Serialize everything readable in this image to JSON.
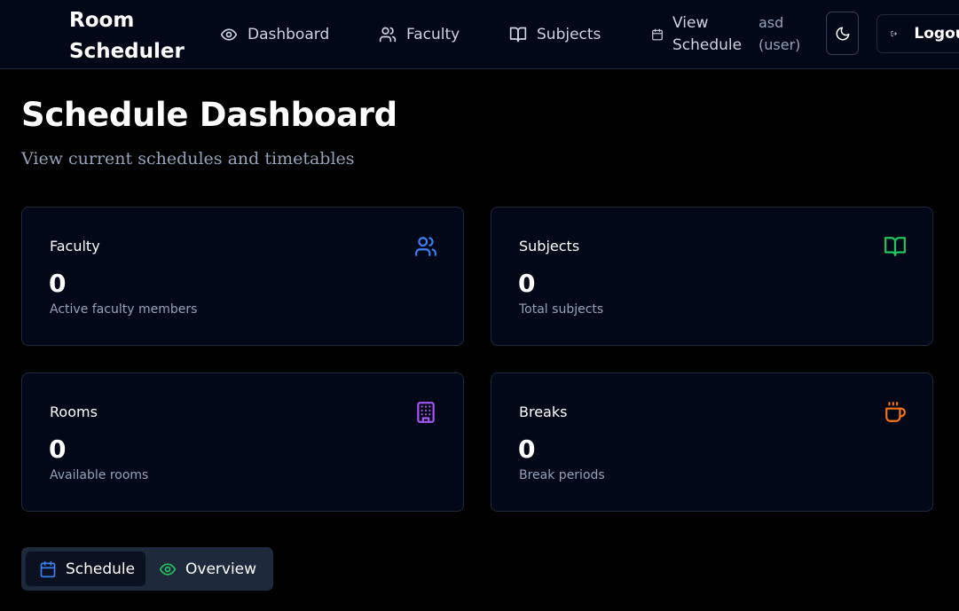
{
  "app": {
    "title_line1": "Room",
    "title_line2": "Scheduler"
  },
  "nav": {
    "dashboard": "Dashboard",
    "faculty": "Faculty",
    "subjects": "Subjects",
    "view_schedule_line1": "View",
    "view_schedule_line2": "Schedule",
    "user_line1": "asd",
    "user_line2": "(user)",
    "logout": "Logout"
  },
  "header": {
    "title": "Schedule Dashboard",
    "subtitle": "View current schedules and timetables"
  },
  "cards": {
    "faculty": {
      "title": "Faculty",
      "value": "0",
      "desc": "Active faculty members",
      "icon": "users-icon",
      "color": "#3b82f6"
    },
    "subjects": {
      "title": "Subjects",
      "value": "0",
      "desc": "Total subjects",
      "icon": "book-open-icon",
      "color": "#22c55e"
    },
    "rooms": {
      "title": "Rooms",
      "value": "0",
      "desc": "Available rooms",
      "icon": "building-icon",
      "color": "#a855f7"
    },
    "breaks": {
      "title": "Breaks",
      "value": "0",
      "desc": "Break periods",
      "icon": "coffee-icon",
      "color": "#f97316"
    }
  },
  "tabs": {
    "schedule": "Schedule",
    "overview": "Overview",
    "active": "schedule"
  },
  "colors": {
    "background": "#000000",
    "surface": "#020817",
    "border": "#1e293b",
    "muted_text": "#94a3b8"
  }
}
